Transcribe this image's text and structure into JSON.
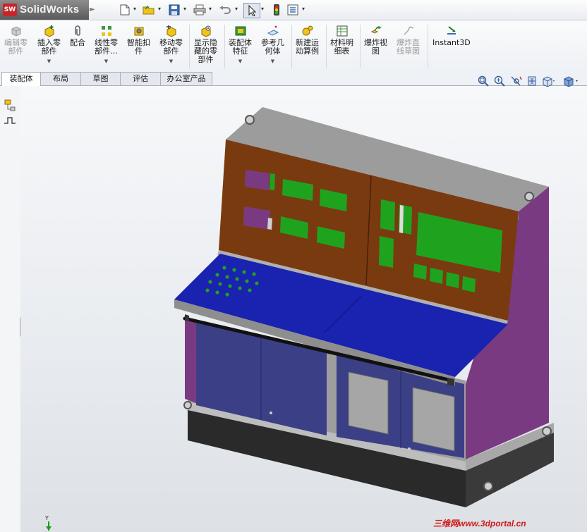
{
  "app": {
    "name": "SolidWorks",
    "logo_mark": "SW"
  },
  "quick_access": [
    {
      "icon": "new-document-icon"
    },
    {
      "icon": "open-folder-icon"
    },
    {
      "icon": "save-icon"
    },
    {
      "icon": "print-icon"
    },
    {
      "icon": "undo-icon"
    },
    {
      "icon": "select-arrow-icon"
    },
    {
      "icon": "rebuild-traffic-light-icon"
    },
    {
      "icon": "options-icon"
    }
  ],
  "ribbon": {
    "buttons": [
      {
        "label": "编辑零\n部件",
        "enabled": false,
        "dropdown": false
      },
      {
        "label": "插入零\n部件",
        "enabled": true,
        "dropdown": true
      },
      {
        "label": "配合",
        "enabled": true,
        "dropdown": false
      },
      {
        "label": "线性零\n部件…",
        "enabled": true,
        "dropdown": true
      },
      {
        "label": "智能扣\n件",
        "enabled": true,
        "dropdown": false
      },
      {
        "label": "移动零\n部件",
        "enabled": true,
        "dropdown": true
      },
      {
        "label": "显示隐\n藏的零\n部件",
        "enabled": true,
        "dropdown": false
      },
      {
        "label": "装配体\n特征",
        "enabled": true,
        "dropdown": true
      },
      {
        "label": "参考几\n何体",
        "enabled": true,
        "dropdown": true
      },
      {
        "label": "新建运\n动算例",
        "enabled": true,
        "dropdown": false
      },
      {
        "label": "材料明\n细表",
        "enabled": true,
        "dropdown": false
      },
      {
        "label": "爆炸视\n图",
        "enabled": true,
        "dropdown": false
      },
      {
        "label": "爆炸直\n线草图",
        "enabled": false,
        "dropdown": false
      },
      {
        "label": "Instant3D",
        "enabled": true,
        "dropdown": false
      }
    ]
  },
  "tabs": [
    {
      "label": "装配体",
      "active": true
    },
    {
      "label": "布局",
      "active": false
    },
    {
      "label": "草图",
      "active": false
    },
    {
      "label": "评估",
      "active": false
    },
    {
      "label": "办公室产品",
      "active": false
    }
  ],
  "view_toolbar": [
    {
      "icon": "zoom-to-fit-icon"
    },
    {
      "icon": "zoom-to-area-icon"
    },
    {
      "icon": "previous-view-icon"
    },
    {
      "icon": "section-view-icon"
    },
    {
      "icon": "view-orientation-icon"
    },
    {
      "icon": "display-style-icon"
    }
  ],
  "colors": {
    "brand_red": "#c8252b",
    "cabinet_magenta": "#7a3a82",
    "panel_brown": "#7a3a10",
    "desk_blue": "#1a22b0",
    "lower_navy": "#3a3f86",
    "screen_green": "#1fa31f"
  },
  "axis_indicator": {
    "label": "Y"
  },
  "watermark": "三维网www.3dportal.cn"
}
